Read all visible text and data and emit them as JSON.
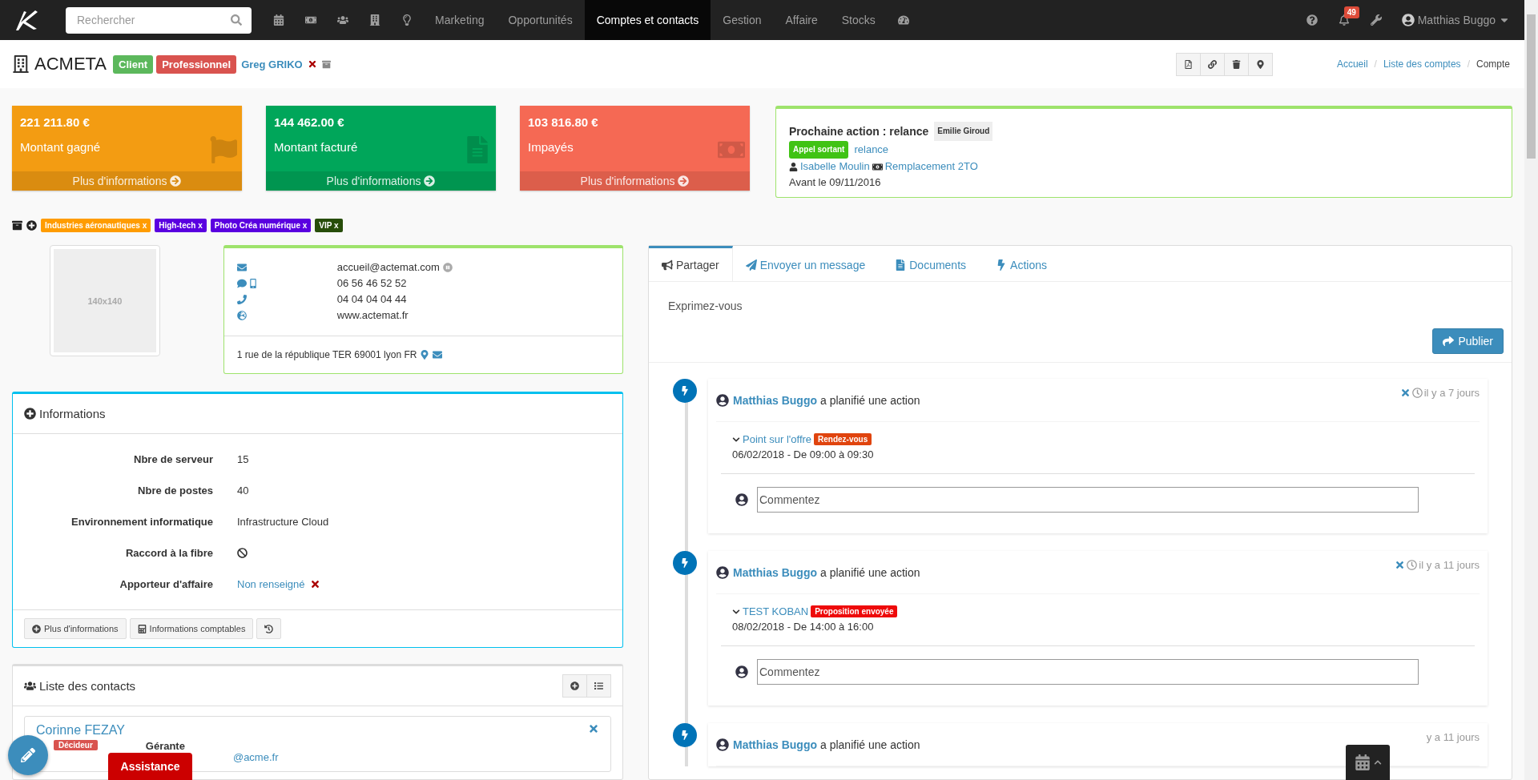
{
  "navbar": {
    "search_placeholder": "Rechercher",
    "menu": [
      {
        "label": "Marketing",
        "selected": false
      },
      {
        "label": "Opportunités",
        "selected": false
      },
      {
        "label": "Comptes et contacts",
        "selected": true
      },
      {
        "label": "Gestion",
        "selected": false
      },
      {
        "label": "Affaire",
        "selected": false
      },
      {
        "label": "Stocks",
        "selected": false
      }
    ],
    "notification_count": "49",
    "user": "Matthias Buggo"
  },
  "account": {
    "name": "ACMETA",
    "badges": [
      {
        "label": "Client",
        "color": "#5cb85c"
      },
      {
        "label": "Professionnel",
        "color": "#d9534f"
      }
    ],
    "owner": "Greg GRIKO"
  },
  "breadcrumb_separator": "/",
  "breadcrumb": [
    {
      "label": "Accueil",
      "link": true
    },
    {
      "label": "Liste des comptes",
      "link": true
    },
    {
      "label": "Compte",
      "link": false
    }
  ],
  "stats": [
    {
      "value": "221 211.80 €",
      "label": "Montant gagné",
      "more": "Plus d'informations",
      "color": "#f39c12",
      "kind": "flag"
    },
    {
      "value": "144 462.00 €",
      "label": "Montant facturé",
      "more": "Plus d'informations",
      "color": "#00a65a",
      "kind": "invoice"
    },
    {
      "value": "103 816.80 €",
      "label": "Impayés",
      "more": "Plus d'informations",
      "color": "#f56954",
      "kind": "cash"
    }
  ],
  "next_action": {
    "title": "Prochaine action : relance",
    "assignee": "Emilie Giroud",
    "type": "Appel sortant",
    "type_link": "relance",
    "person": "Isabelle Moulin",
    "deal": "Remplacement 2TO",
    "deadline": "Avant le 09/11/2016"
  },
  "tags": [
    {
      "label": "Industries aéronautiques x",
      "color": "#ff9c00"
    },
    {
      "label": "High-tech x",
      "color": "#5a00e0"
    },
    {
      "label": "Photo Créa numérique x",
      "color": "#5a00e0"
    },
    {
      "label": "VIP x",
      "color": "#274d0a"
    }
  ],
  "photo": {
    "caption": "140x140"
  },
  "contact": {
    "lines": [
      {
        "kind": "email",
        "value": "accueil@actemat.com"
      },
      {
        "kind": "mobile",
        "value": "06 56 46 52 52"
      },
      {
        "kind": "phone",
        "value": "04 04 04 04 44"
      },
      {
        "kind": "web",
        "value": "www.actemat.fr"
      }
    ],
    "address": "1 rue de la république TER 69001 lyon FR"
  },
  "informations": {
    "title": "Informations",
    "fields": [
      {
        "label": "Nbre de serveur",
        "kind": "text",
        "value": "15"
      },
      {
        "label": "Nbre de postes",
        "kind": "text",
        "value": "40"
      },
      {
        "label": "Environnement informatique",
        "kind": "text",
        "value": "Infrastructure Cloud"
      },
      {
        "label": "Raccord à la fibre",
        "kind": "blocked"
      },
      {
        "label": "Apporteur d'affaire",
        "kind": "link",
        "value": "Non renseigné"
      }
    ],
    "buttons": [
      "Plus d'informations",
      "Informations comptables"
    ]
  },
  "contacts": {
    "title": "Liste des contacts",
    "items": [
      {
        "name": "Corinne FEZAY",
        "role": "Décideur",
        "job": "Gérante",
        "email": "@acme.fr"
      }
    ]
  },
  "feed": {
    "tabs": [
      {
        "label": "Partager",
        "selected": true
      },
      {
        "label": "Envoyer un message",
        "selected": false
      },
      {
        "label": "Documents",
        "selected": false
      },
      {
        "label": "Actions",
        "selected": false
      }
    ],
    "placeholder": "Exprimez-vous",
    "publish": "Publier",
    "items": [
      {
        "author": "Matthias Buggo",
        "verb": "a planifié une action",
        "time": "il y a 7 jours",
        "title": "Point sur l'offre",
        "status": "Rendez-vous",
        "color": "#e0440e",
        "date": "06/02/2018 - De 09:00 à 09:30",
        "comment_placeholder": "Commentez"
      },
      {
        "author": "Matthias Buggo",
        "verb": "a planifié une action",
        "time": "il y a 11 jours",
        "title": "TEST KOBAN",
        "status": "Proposition envoyée",
        "color": "#ee0a0a",
        "date": "08/02/2018 - De 14:00 à 16:00",
        "comment_placeholder": "Commentez"
      },
      {
        "author": "Matthias Buggo",
        "verb": "a planifié une action",
        "time": "y a 11 jours"
      }
    ]
  },
  "assistance": "Assistance"
}
